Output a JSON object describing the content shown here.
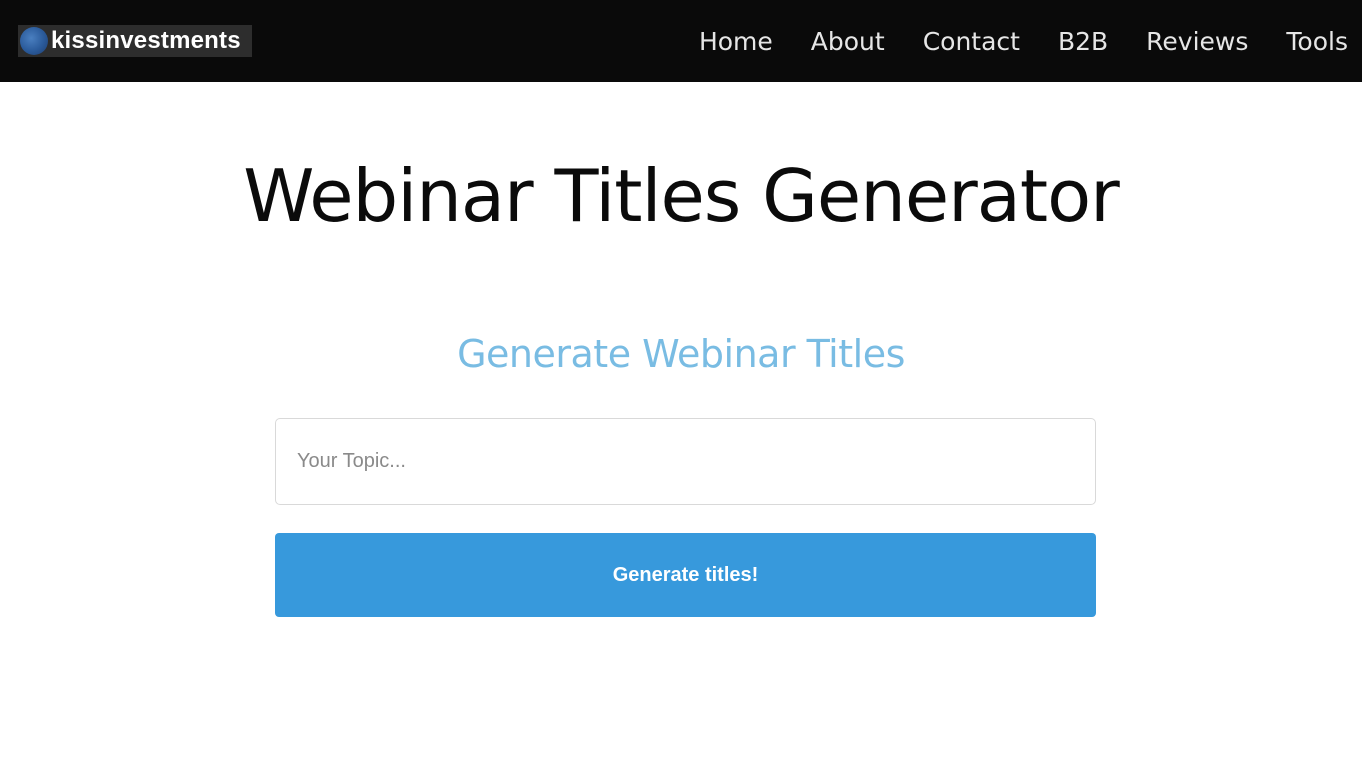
{
  "header": {
    "logo_text": "kissinvestments",
    "nav": {
      "home": "Home",
      "about": "About",
      "contact": "Contact",
      "b2b": "B2B",
      "reviews": "Reviews",
      "tools": "Tools"
    }
  },
  "main": {
    "title": "Webinar Titles Generator",
    "subtitle": "Generate Webinar Titles",
    "topic_input": {
      "value": "",
      "placeholder": "Your Topic..."
    },
    "generate_button_label": "Generate titles!"
  },
  "colors": {
    "navbar_background": "#0a0a0a",
    "subtitle": "#79bce3",
    "button_background": "#3799dc"
  }
}
